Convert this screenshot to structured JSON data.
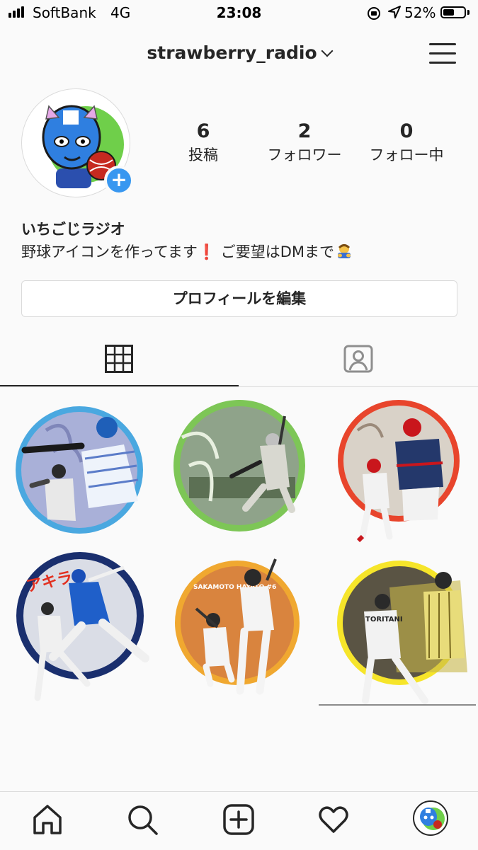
{
  "status_bar": {
    "carrier": "SoftBank",
    "network": "4G",
    "time": "23:08",
    "battery_percent": "52%",
    "battery_level": 0.52
  },
  "header": {
    "username": "strawberry_radio"
  },
  "profile": {
    "stats": [
      {
        "value": "6",
        "label": "投稿"
      },
      {
        "value": "2",
        "label": "フォロワー"
      },
      {
        "value": "0",
        "label": "フォロー中"
      }
    ],
    "display_name": "いちごじラジオ",
    "bio_part1": "野球アイコンを作ってます",
    "bio_emoji1": "❗",
    "bio_part2": " ご要望はDMまで",
    "edit_button": "プロフィールを編集"
  },
  "posts": [
    {
      "ring_color": "#4aa8e0",
      "caption_text": ""
    },
    {
      "ring_color": "#7dc656",
      "caption_text": ""
    },
    {
      "ring_color": "#e8452c",
      "caption_text": ""
    },
    {
      "ring_color": "#1a2f6e",
      "caption_text": "アキラ"
    },
    {
      "ring_color": "#f0a830",
      "caption_text": "SAKAMOTO HAYATO #6"
    },
    {
      "ring_color": "#f6e52a",
      "caption_text": "TORITANI"
    }
  ],
  "icons": [
    "home-icon",
    "search-icon",
    "new-post-icon",
    "activity-heart-icon",
    "profile-avatar-icon"
  ]
}
